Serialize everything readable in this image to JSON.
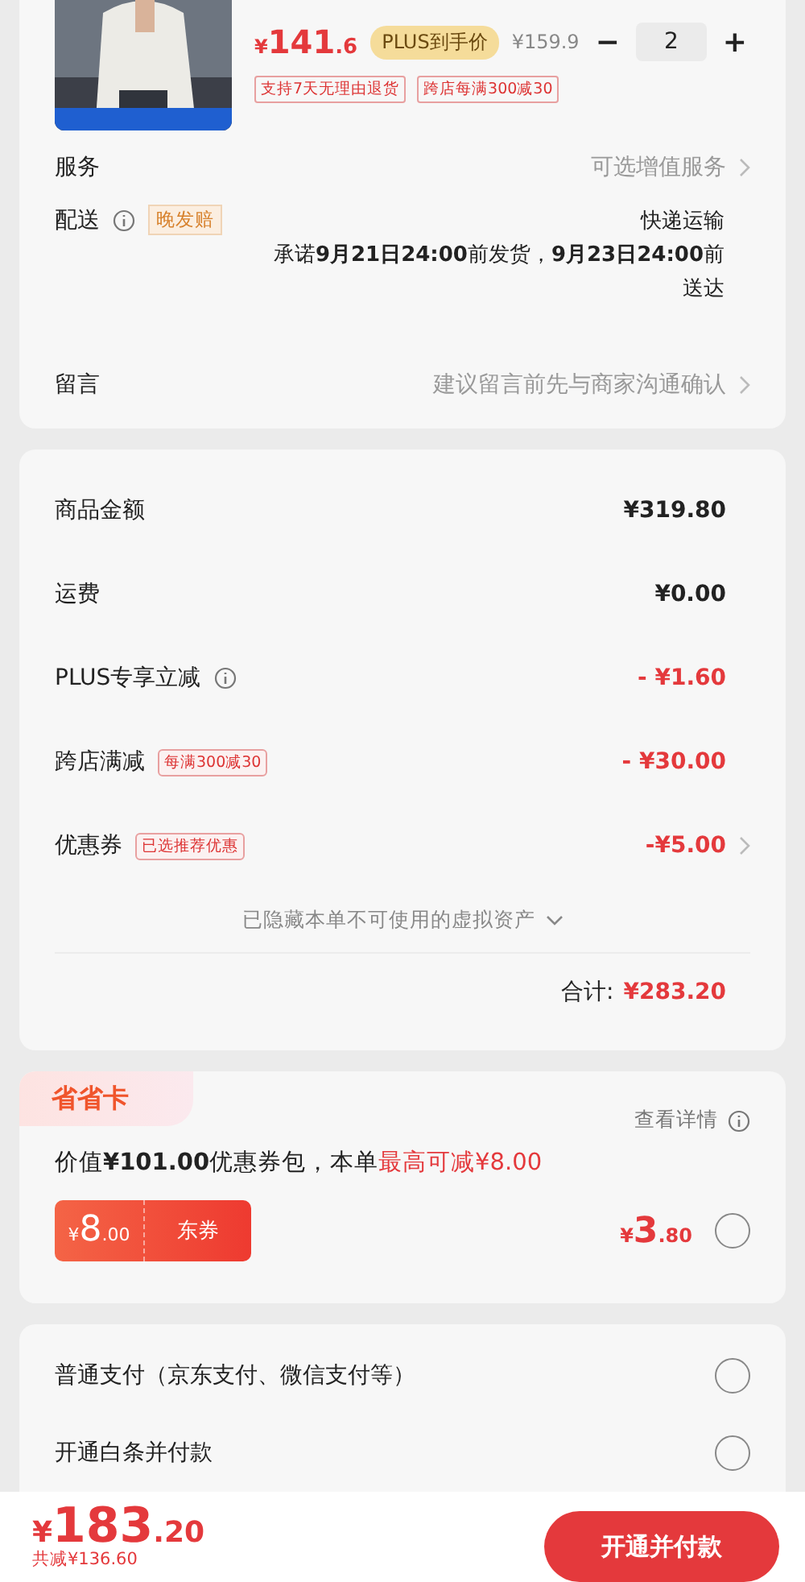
{
  "product": {
    "price_symbol": "¥",
    "price_integer": "141",
    "price_decimal": ".6",
    "plus_badge": "PLUS到手价",
    "original_price": "¥159.9",
    "quantity": {
      "minus": "−",
      "value": "2",
      "plus": "+"
    },
    "tags": [
      "支持7天无理由退货",
      "跨店每满300减30"
    ]
  },
  "order_rows": [
    {
      "kind": "service",
      "label": "服务",
      "value": "可选增值服务"
    },
    {
      "kind": "delivery",
      "label": "配送",
      "badge": "晚发赔",
      "method": "快递运输",
      "promise": "承诺**9月21日24:00**前发货，**9月23日24:00**前送达"
    },
    {
      "kind": "message",
      "label": "留言",
      "placeholder": "建议留言前先与商家沟通确认"
    }
  ],
  "summary": {
    "rows": [
      {
        "label": "商品金额",
        "value": "¥319.80",
        "discount": false
      },
      {
        "label": "运费",
        "value": "¥0.00",
        "discount": false
      },
      {
        "label": "PLUS专享立减",
        "value": "- ¥1.60",
        "discount": true,
        "info": true
      },
      {
        "label": "跨店满减",
        "tag": "每满300减30",
        "value": "- ¥30.00",
        "discount": true
      },
      {
        "label": "优惠券",
        "tag": "已选推荐优惠",
        "value": "-¥5.00",
        "discount": true,
        "chevron": true
      }
    ],
    "hidden_assets": "已隐藏本单不可使用的虚拟资产",
    "total_label": "合计:",
    "total_value": "¥283.20"
  },
  "saver_card": {
    "tab": "省省卡",
    "details": "查看详情",
    "description": "价值**¥101.00**优惠券包，本单",
    "highlight": "最高可减¥8.00",
    "coupon": {
      "symbol": "¥",
      "integer": "8",
      "decimal": ".00",
      "label": "东券"
    },
    "price": {
      "symbol": "¥",
      "integer": "3",
      "decimal": ".80"
    },
    "selected": false
  },
  "payment": [
    {
      "label": "普通支付（京东支付、微信支付等）",
      "selected": false
    },
    {
      "label": "开通白条并付款",
      "selected": false
    }
  ],
  "checkout": {
    "symbol": "¥",
    "integer": "183",
    "decimal": ".20",
    "saved": "共减¥136.60",
    "button": "开通并付款"
  }
}
